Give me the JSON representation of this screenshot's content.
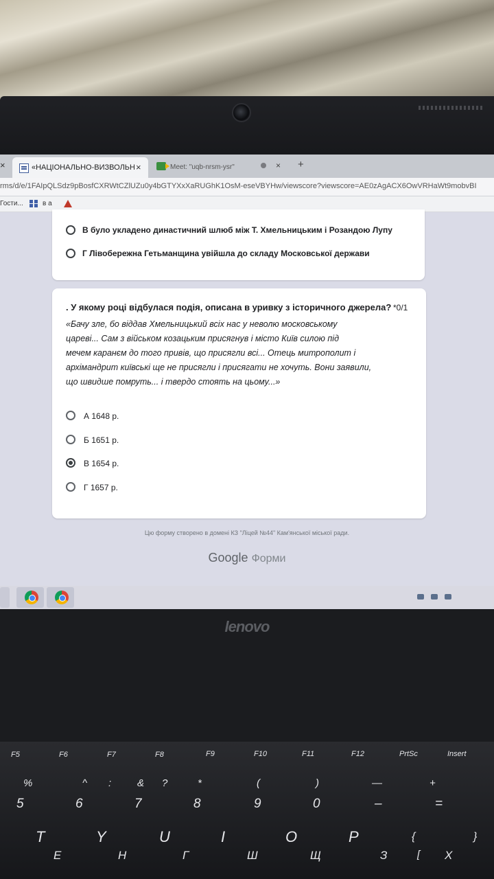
{
  "browser": {
    "tabs": [
      {
        "title": "«НАЦІОНАЛЬНО-ВИЗВОЛЬНА В",
        "close": "×"
      },
      {
        "title": "Meet: \"uqb-nrsm-ysr\"",
        "close": "×"
      }
    ],
    "new_tab": "+",
    "url": "rms/d/e/1FAIpQLSdz9pBosfCXRWtCZlUZu0y4bGTYXxXaRUGhK1OsM-eseVBYHw/viewscore?viewscore=AE0zAgACX6OwVRHaWt9mobvBI",
    "bookmarks": [
      "Гости...",
      "в а"
    ]
  },
  "prev_card": {
    "options": [
      {
        "label": "В було укладено династичний шлюб між Т. Хмельницьким і Розандою Лупу",
        "checked": false
      },
      {
        "label": "Г Лівобережна Гетьманщина увійшла до складу Московської держави",
        "checked": false
      }
    ]
  },
  "question": {
    "title": ". У якому році відбулася подія, описана в уривку з історичного джерела?",
    "points": "*0/1",
    "quote_lines": [
      "«Бачу зле, бо віддав Хмельницький всіх нас у неволю московському",
      "цареві... Сам з військом козацьким присягнув і місто Київ силою під",
      "мечем каранєм до того привів, що присягли всі... Отець митрополит і",
      "архімандрит київські ще не присягли і присягати не хочуть. Вони заявили,",
      "що швидше помруть... і твердо стоять на цьому...»"
    ],
    "options": [
      {
        "label": "А 1648 р.",
        "checked": false
      },
      {
        "label": "Б 1651 р.",
        "checked": false
      },
      {
        "label": "В 1654 р.",
        "checked": true
      },
      {
        "label": "Г 1657 р.",
        "checked": false
      }
    ]
  },
  "footer": {
    "note": "Цю форму створено в домені КЗ \"Ліцей №44\" Кам'янської міської ради.",
    "brand": "Google",
    "brand_suffix": "Форми"
  },
  "laptop": {
    "brand": "lenovo",
    "fkeys": [
      "F5",
      "F6",
      "F7",
      "F8",
      "F9",
      "F10",
      "F11",
      "F12",
      "PrtSc",
      "Insert"
    ],
    "num_row_top": [
      "%",
      "^",
      ":",
      "&",
      "?",
      "*",
      "(",
      ")",
      "—",
      "+"
    ],
    "num_row": [
      "5",
      "6",
      "7",
      "8",
      "9",
      "0",
      "–",
      "="
    ],
    "letters_en": [
      "T",
      "Y",
      "U",
      "I",
      "O",
      "P",
      "{",
      "}"
    ],
    "letters_ua": [
      "Е",
      "Н",
      "Г",
      "Ш",
      "Щ",
      "З",
      "[",
      "Х"
    ]
  },
  "colors": {
    "screen_bg": "#dadbe7",
    "card_bg": "#ffffff",
    "text": "#202124"
  }
}
